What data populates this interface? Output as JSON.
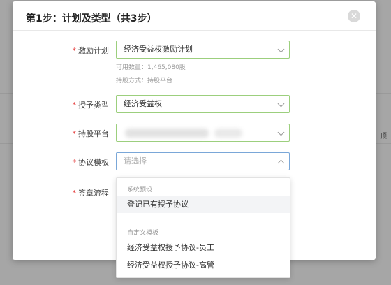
{
  "background": {
    "edge_text": "顶"
  },
  "modal": {
    "title": "第1步：计划及类型（共3步）",
    "close_symbol": "✕"
  },
  "form": {
    "incentive_plan": {
      "label": "激励计划",
      "value": "经济受益权激励计划",
      "available_qty": "可用数量：1,465,080股",
      "holding_method": "持股方式：持股平台"
    },
    "grant_type": {
      "label": "授予类型",
      "value": "经济受益权"
    },
    "holding_platform": {
      "label": "持股平台"
    },
    "agreement_template": {
      "label": "协议模板",
      "placeholder": "请选择"
    },
    "signing_process": {
      "label": "签章流程"
    }
  },
  "dropdown": {
    "groups": [
      {
        "title": "系统预设",
        "options": [
          "登记已有授予协议"
        ]
      },
      {
        "title": "自定义模板",
        "options": [
          "经济受益权授予协议-员工",
          "经济受益权授予协议-高管"
        ]
      }
    ]
  },
  "colors": {
    "required": "#e64545",
    "valid_border": "#9ccf7d",
    "focus_border": "#7aa7d8"
  }
}
